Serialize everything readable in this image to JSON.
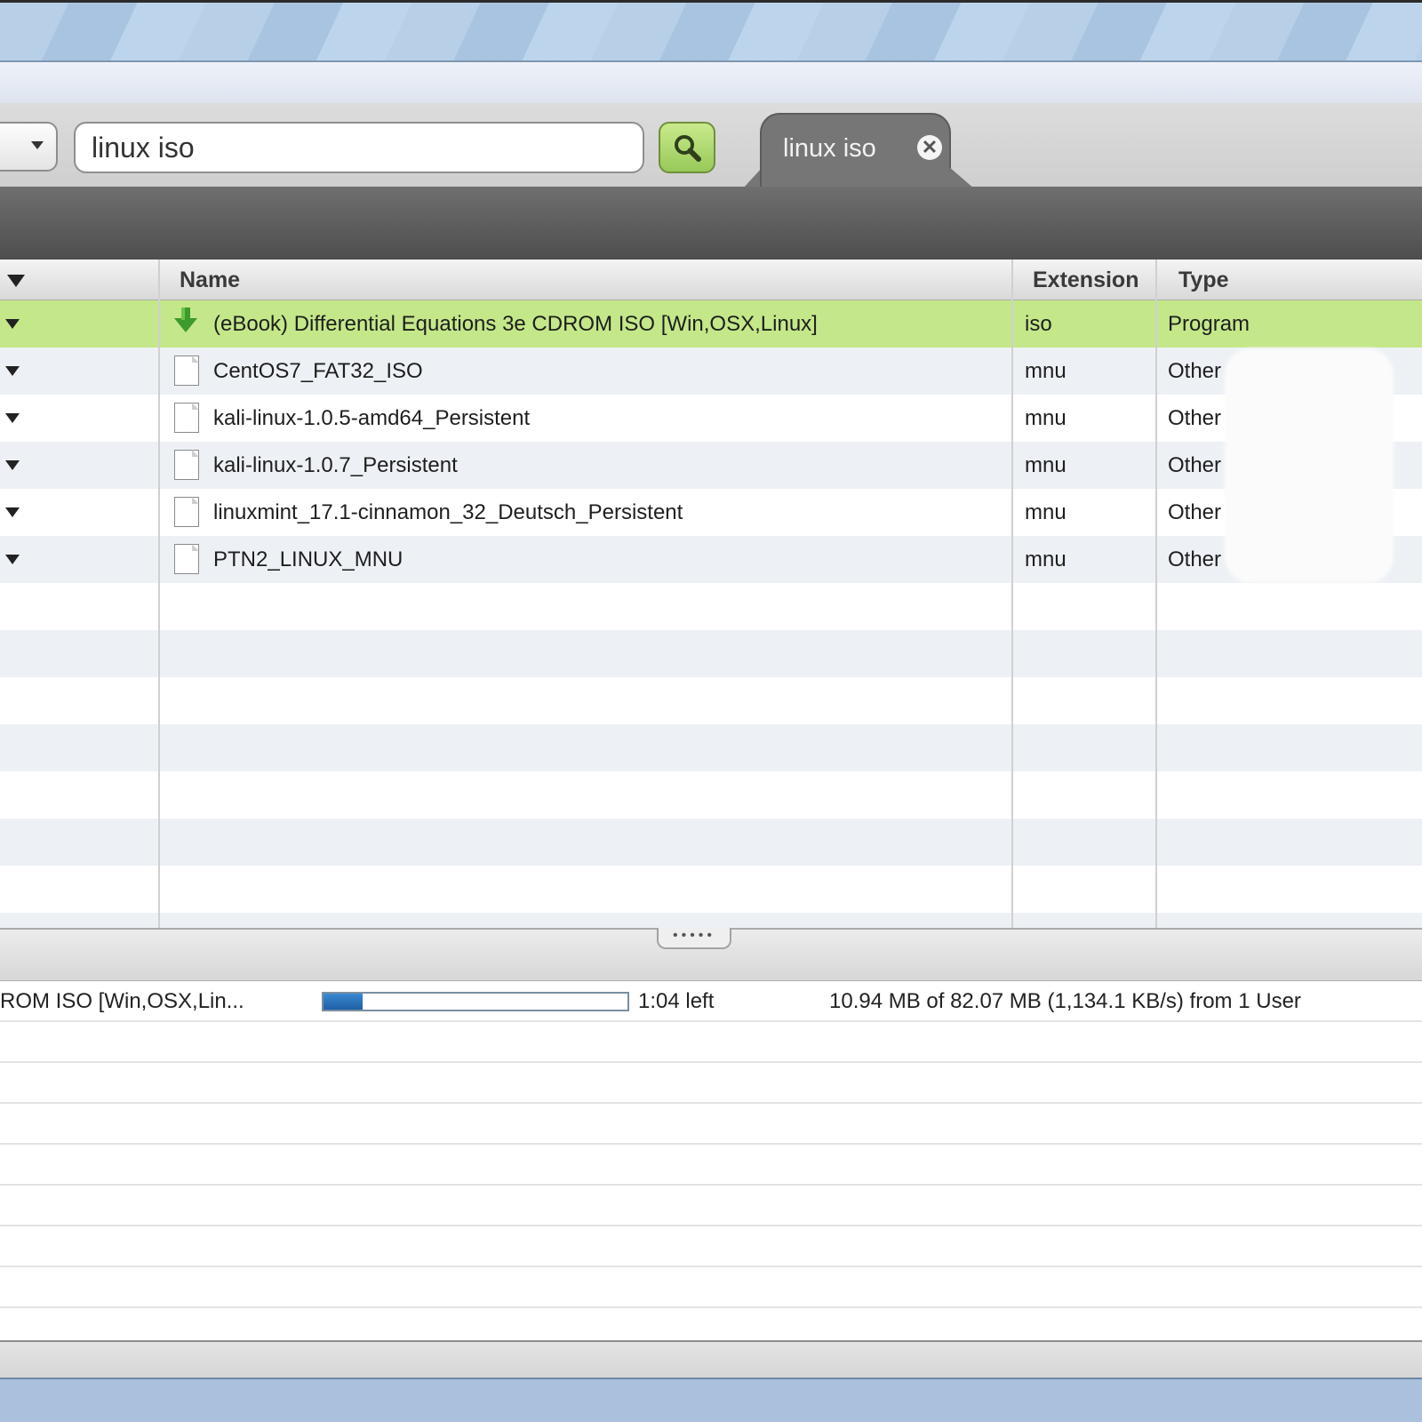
{
  "search": {
    "query": "linux iso",
    "tab_label": "linux iso",
    "tab_close_glyph": "✕"
  },
  "columns": {
    "name": "Name",
    "extension": "Extension",
    "type": "Type"
  },
  "results": [
    {
      "name": "(eBook) Differential Equations 3e CDROM ISO [Win,OSX,Linux]",
      "extension": "iso",
      "type": "Program",
      "icon": "download-arrow-icon",
      "selected": true
    },
    {
      "name": "CentOS7_FAT32_ISO",
      "extension": "mnu",
      "type": "Other",
      "icon": "file-icon"
    },
    {
      "name": "kali-linux-1.0.5-amd64_Persistent",
      "extension": "mnu",
      "type": "Other",
      "icon": "file-icon"
    },
    {
      "name": "kali-linux-1.0.7_Persistent",
      "extension": "mnu",
      "type": "Other",
      "icon": "file-icon"
    },
    {
      "name": "linuxmint_17.1-cinnamon_32_Deutsch_Persistent",
      "extension": "mnu",
      "type": "Other",
      "icon": "file-icon"
    },
    {
      "name": "PTN2_LINUX_MNU",
      "extension": "mnu",
      "type": "Other",
      "icon": "file-icon"
    }
  ],
  "transfer": {
    "name": "ROM ISO [Win,OSX,Lin...",
    "progress_fraction": 0.13,
    "time_left": "1:04 left",
    "details": "10.94 MB of 82.07 MB (1,134.1 KB/s) from 1 User"
  },
  "splitter_grip": "•••••",
  "colors": {
    "selected_row": "#c4e889",
    "search_button": "#98c95a",
    "progress": "#1f5fa6"
  }
}
